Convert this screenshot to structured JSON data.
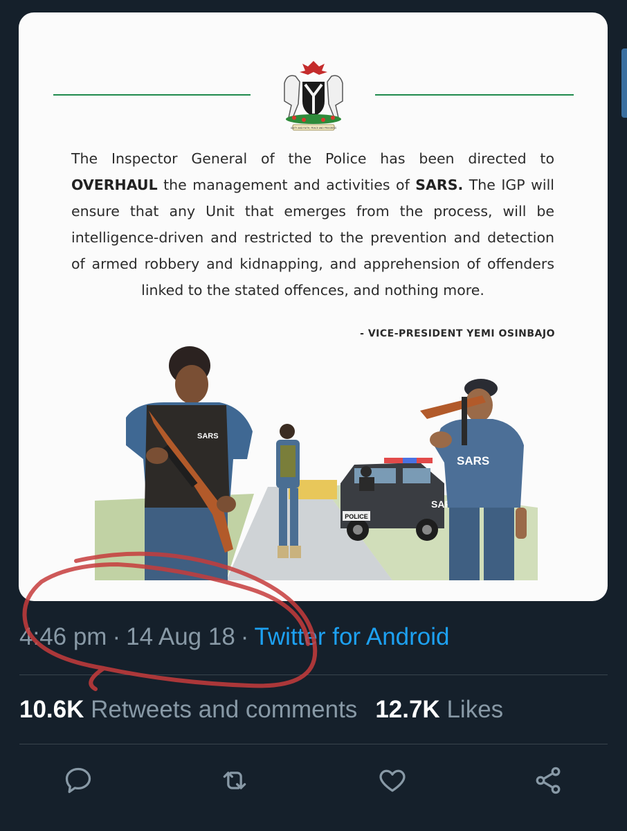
{
  "tweet_image": {
    "quote_parts": {
      "p1": "The Inspector General of the Police has been directed to ",
      "bold1": "OVERHAUL",
      "p2": " the management and activities of ",
      "bold2": "SARS.",
      "p3": " The IGP will ensure that any Unit that emerges from the process, will be intelligence-driven and restricted to the prevention and detection of armed robbery and kidnapping, and apprehension of offenders linked to the stated offences, and nothing more."
    },
    "attribution": "- VICE-PRESIDENT YEMI OSINBAJO",
    "crest_motto": "UNITY AND FAITH, PEACE AND PROGRESS",
    "vest_labels": [
      "SARS",
      "SARS",
      "SARS",
      "POLICE"
    ]
  },
  "meta": {
    "time": "4:46 pm",
    "separator": "·",
    "date": "14 Aug 18",
    "source": "Twitter for Android"
  },
  "stats": {
    "retweets_count": "10.6K",
    "retweets_label": "Retweets and comments",
    "likes_count": "12.7K",
    "likes_label": "Likes"
  },
  "actions": [
    "reply-icon",
    "retweet-icon",
    "like-icon",
    "share-icon"
  ],
  "colors": {
    "background": "#15202b",
    "accent": "#1da1f2",
    "muted": "#8899a6",
    "annotation": "#c63c3c"
  }
}
